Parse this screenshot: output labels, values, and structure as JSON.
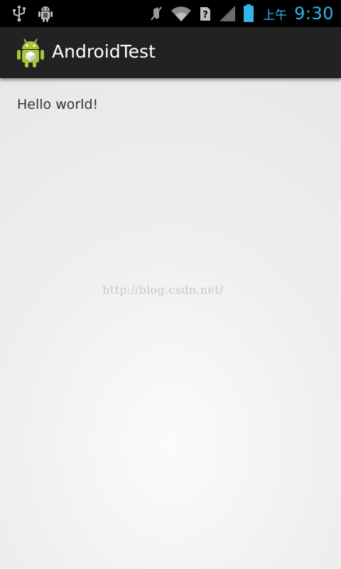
{
  "status_bar": {
    "left_icons": [
      "usb-icon",
      "android-debug-icon"
    ],
    "right_icons": [
      "vibrate-off-icon",
      "wifi-icon",
      "no-sim-icon",
      "signal-icon",
      "battery-icon"
    ],
    "ampm": "上午",
    "time": "9:30",
    "accent_color": "#33b5e5"
  },
  "action_bar": {
    "app_icon": "android-robot-icon",
    "title": "AndroidTest"
  },
  "content": {
    "text": "Hello world!"
  },
  "watermark": "http://blog.csdn.net/"
}
